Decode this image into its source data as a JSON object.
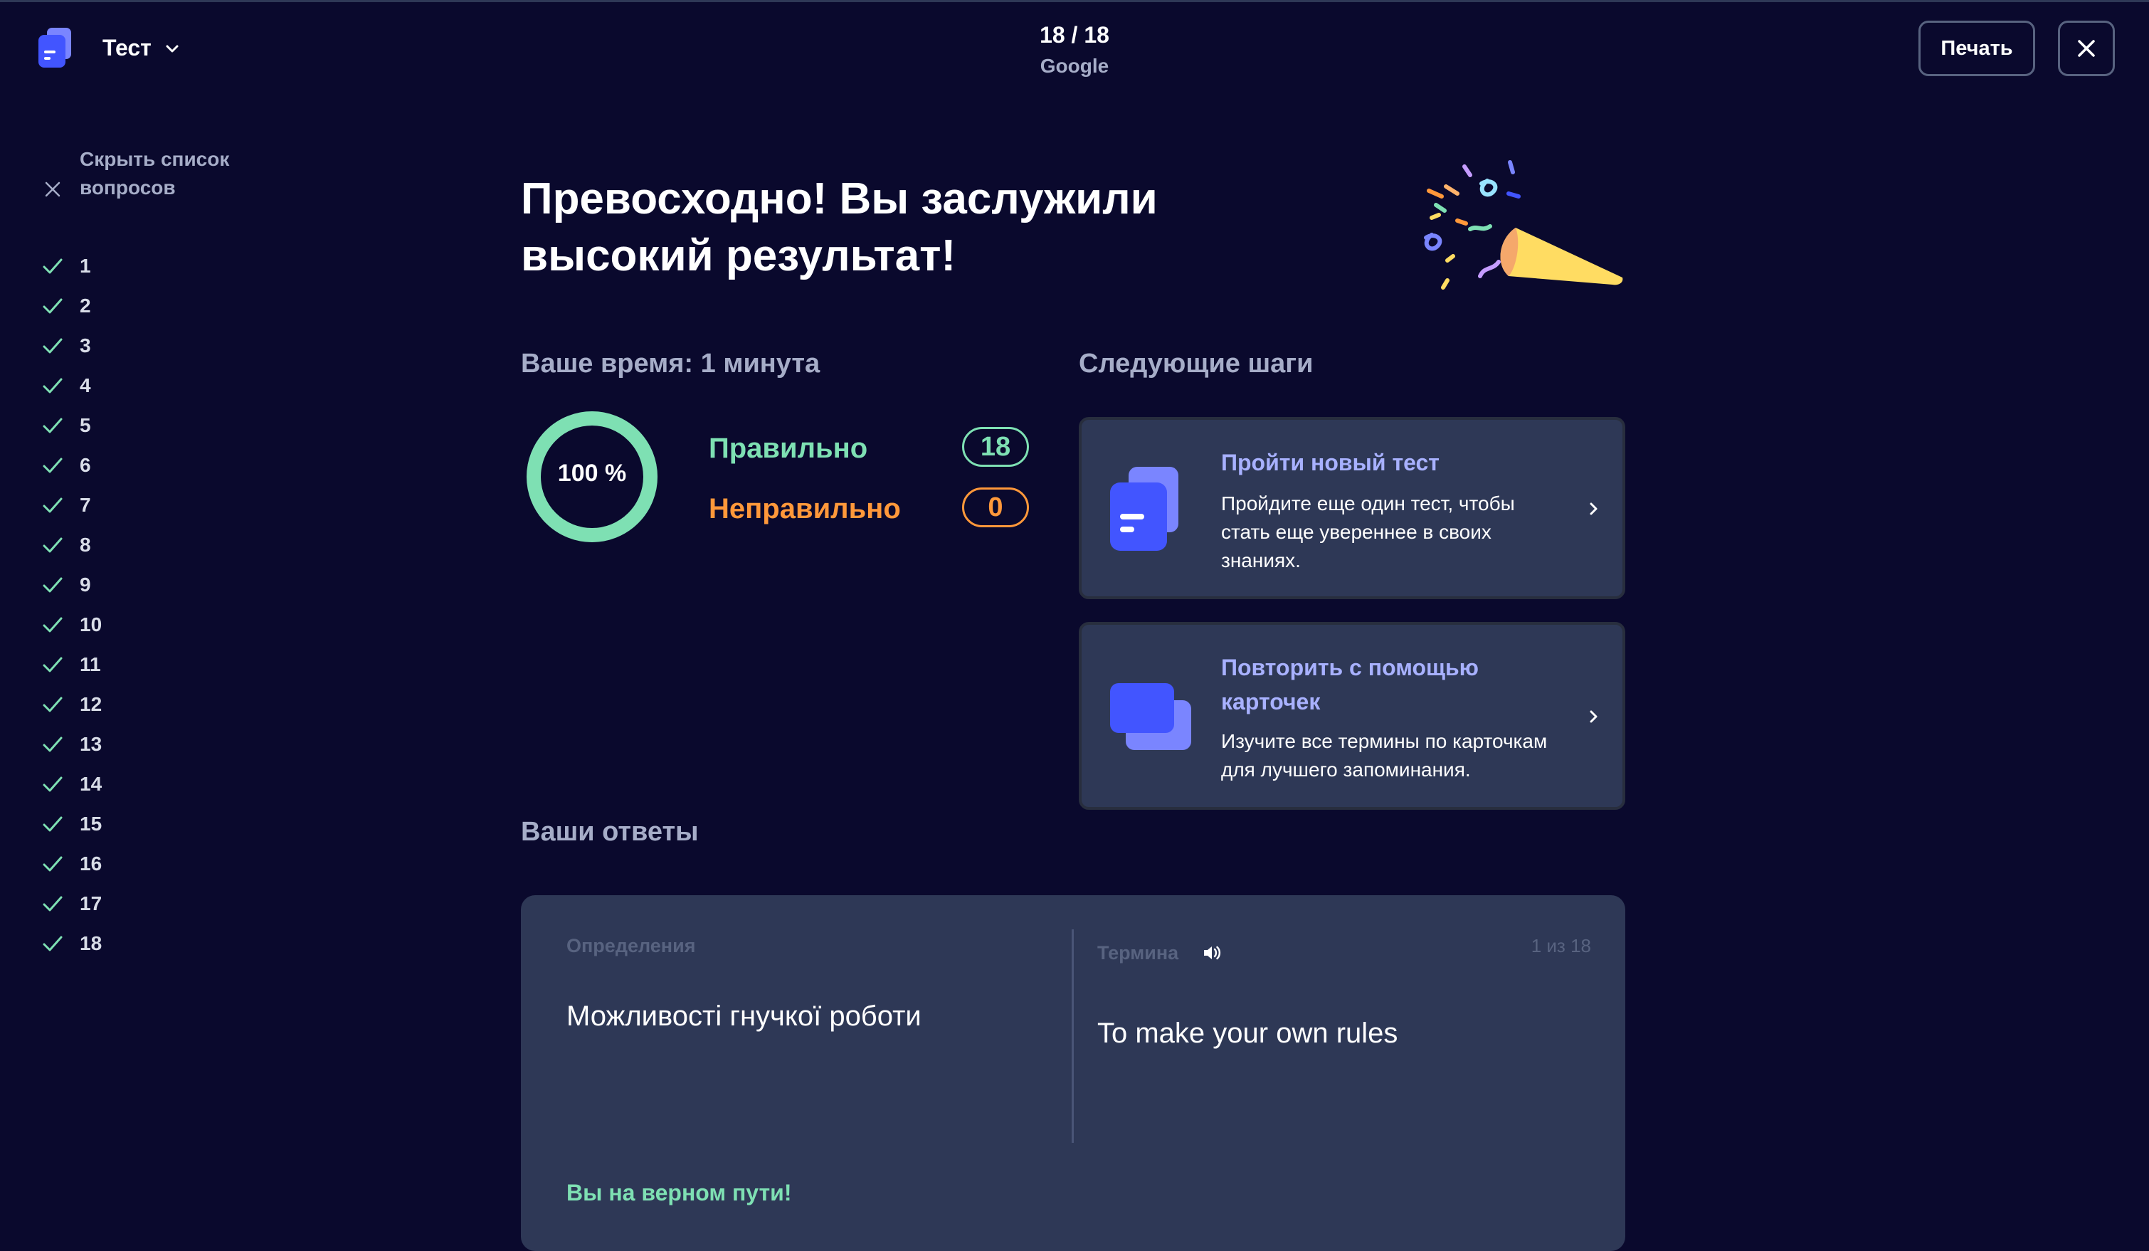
{
  "header": {
    "title": "Тест",
    "progress_count": "18 / 18",
    "progress_sub": "Google",
    "print_label": "Печать"
  },
  "sidebar": {
    "hide_label": "Скрыть список вопросов",
    "questions": [
      "1",
      "2",
      "3",
      "4",
      "5",
      "6",
      "7",
      "8",
      "9",
      "10",
      "11",
      "12",
      "13",
      "14",
      "15",
      "16",
      "17",
      "18"
    ]
  },
  "result": {
    "title": "Превосходно! Вы заслужили высокий результат!",
    "time_label": "Ваше время: 1 минута",
    "percent_label": "100 %",
    "percent_value": 100,
    "correct_label": "Правильно",
    "correct_count": "18",
    "incorrect_label": "Неправильно",
    "incorrect_count": "0"
  },
  "next_steps": {
    "title": "Следующие шаги",
    "cards": [
      {
        "title": "Пройти новый тест",
        "desc": "Пройдите еще один тест, чтобы стать еще увереннее в своих знаниях."
      },
      {
        "title": "Повторить с помощью карточек",
        "desc": "Изучите все термины по карточкам для лучшего запоминания."
      }
    ]
  },
  "answers": {
    "title": "Ваши ответы",
    "definition_label": "Определения",
    "term_label": "Термина",
    "counter": "1 из 18",
    "definition": "Можливості гнучкої роботи",
    "term": "To make your own rules",
    "feedback": "Вы на верном пути!"
  },
  "colors": {
    "background": "#0a092d",
    "card": "#2e3856",
    "correct": "#7ee0b3",
    "incorrect": "#ff983a",
    "accent": "#a8b1ff",
    "brand": "#4255ff"
  },
  "icons": [
    "logo-icon",
    "chevron-down-icon",
    "close-icon",
    "check-icon",
    "party-popper-icon",
    "test-icon",
    "flashcards-icon",
    "chevron-right-icon",
    "audio-icon"
  ]
}
